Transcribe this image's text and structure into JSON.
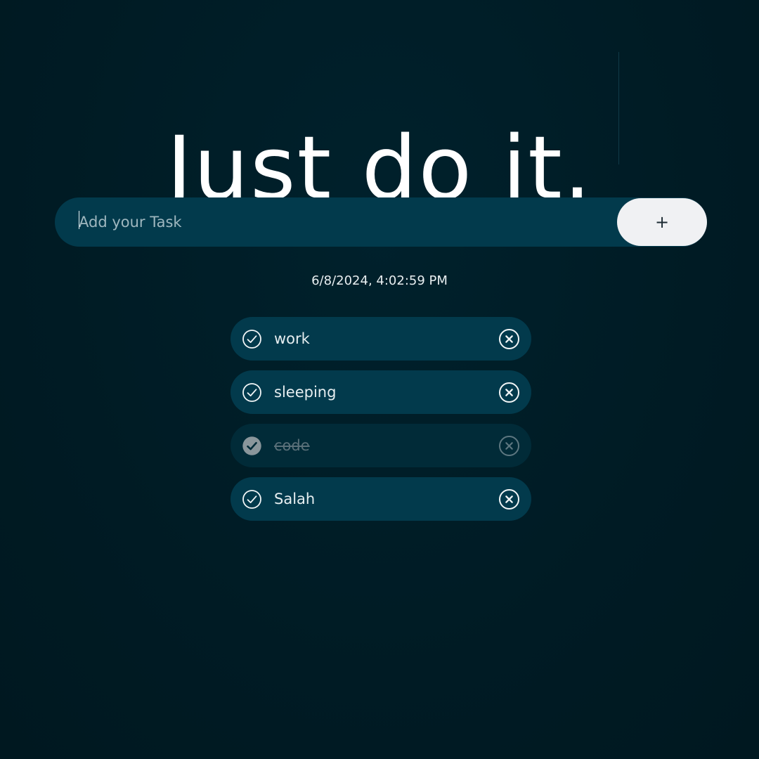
{
  "header": {
    "title": "Just do it."
  },
  "task_form": {
    "placeholder": "Add your Task",
    "value": "",
    "add_label": "+"
  },
  "timestamp": "6/8/2024, 4:02:59 PM",
  "tasks": [
    {
      "label": "work",
      "done": false,
      "check_icon": "circle-check-icon",
      "delete_icon": "circle-x-icon"
    },
    {
      "label": "sleeping",
      "done": false,
      "check_icon": "circle-check-icon",
      "delete_icon": "circle-x-icon"
    },
    {
      "label": "code",
      "done": true,
      "check_icon": "filled-circle-check-icon",
      "delete_icon": "circle-x-icon"
    },
    {
      "label": "Salah",
      "done": false,
      "check_icon": "circle-check-icon",
      "delete_icon": "circle-x-icon"
    }
  ],
  "colors": {
    "background": "#001b24",
    "panel": "#023a4c",
    "panel_done": "#012b38",
    "button": "#f0f1f3",
    "text": "#e6eef0",
    "muted_text": "#5a7079"
  }
}
